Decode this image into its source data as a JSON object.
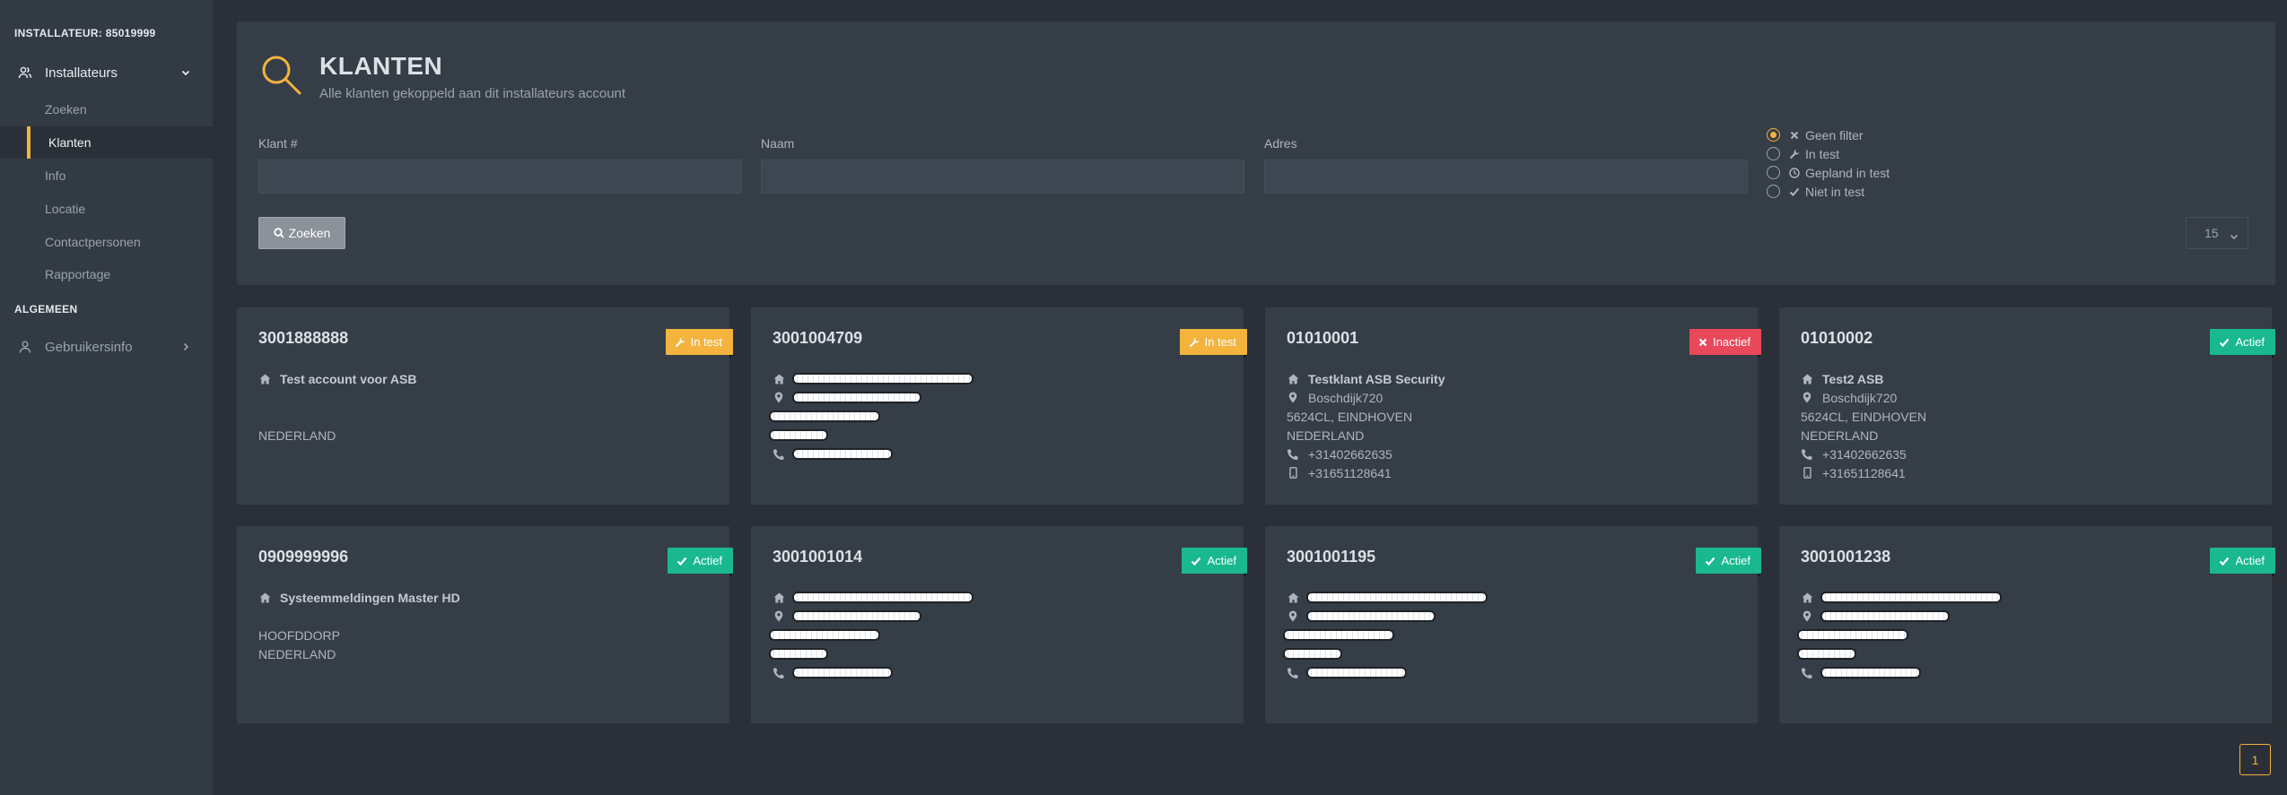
{
  "sidebar": {
    "installer_title": "INSTALLATEUR: 85019999",
    "group_label": "Installateurs",
    "items": [
      {
        "label": "Zoeken",
        "active": false
      },
      {
        "label": "Klanten",
        "active": true
      },
      {
        "label": "Info",
        "active": false
      },
      {
        "label": "Locatie",
        "active": false
      },
      {
        "label": "Contactpersonen",
        "active": false
      },
      {
        "label": "Rapportage",
        "active": false
      }
    ],
    "section_label": "ALGEMEEN",
    "user_label": "Gebruikersinfo"
  },
  "header": {
    "title": "KLANTEN",
    "subtitle": "Alle klanten gekoppeld aan dit installateurs account"
  },
  "filters": {
    "klant_label": "Klant #",
    "klant_value": "",
    "naam_label": "Naam",
    "naam_value": "",
    "adres_label": "Adres",
    "adres_value": "",
    "status_options": [
      {
        "label": "Geen filter",
        "icon": "times-icon",
        "selected": true
      },
      {
        "label": "In test",
        "icon": "wrench-icon",
        "selected": false
      },
      {
        "label": "Gepland in test",
        "icon": "clock-icon",
        "selected": false
      },
      {
        "label": "Niet in test",
        "icon": "check-icon",
        "selected": false
      }
    ],
    "search_label": "Zoeken",
    "page_size": "15"
  },
  "colors": {
    "accent": "#f3b33d",
    "active": "#19b88f",
    "inactive": "#e9485a"
  },
  "cards": [
    {
      "number": "3001888888",
      "status": "In test",
      "status_type": "test",
      "name": "Test account voor ASB",
      "street": "",
      "city": "",
      "country": "NEDERLAND",
      "phone": "",
      "mobile": "",
      "redacted": false
    },
    {
      "number": "3001004709",
      "status": "In test",
      "status_type": "test",
      "name": "",
      "street": "",
      "city": "",
      "country": "",
      "phone": "",
      "mobile": "",
      "redacted": true
    },
    {
      "number": "01010001",
      "status": "Inactief",
      "status_type": "inactive",
      "name": "Testklant ASB Security",
      "street": "Boschdijk720",
      "city": "5624CL, EINDHOVEN",
      "country": "NEDERLAND",
      "phone": "+31402662635",
      "mobile": "+31651128641",
      "redacted": false
    },
    {
      "number": "01010002",
      "status": "Actief",
      "status_type": "active",
      "name": "Test2 ASB",
      "street": "Boschdijk720",
      "city": "5624CL, EINDHOVEN",
      "country": "NEDERLAND",
      "phone": "+31402662635",
      "mobile": "+31651128641",
      "redacted": false
    },
    {
      "number": "0909999996",
      "status": "Actief",
      "status_type": "active",
      "name": "Systeemmeldingen Master HD",
      "street": "",
      "city": "HOOFDDORP",
      "country": "NEDERLAND",
      "phone": "",
      "mobile": "",
      "redacted": false
    },
    {
      "number": "3001001014",
      "status": "Actief",
      "status_type": "active",
      "name": "",
      "street": "",
      "city": "",
      "country": "",
      "phone": "",
      "mobile": "",
      "redacted": true
    },
    {
      "number": "3001001195",
      "status": "Actief",
      "status_type": "active",
      "name": "",
      "street": "",
      "city": "",
      "country": "",
      "phone": "",
      "mobile": "",
      "redacted": true
    },
    {
      "number": "3001001238",
      "status": "Actief",
      "status_type": "active",
      "name": "",
      "street": "",
      "city": "",
      "country": "",
      "phone": "",
      "mobile": "",
      "redacted": true
    }
  ],
  "pagination": {
    "current_page": "1"
  }
}
